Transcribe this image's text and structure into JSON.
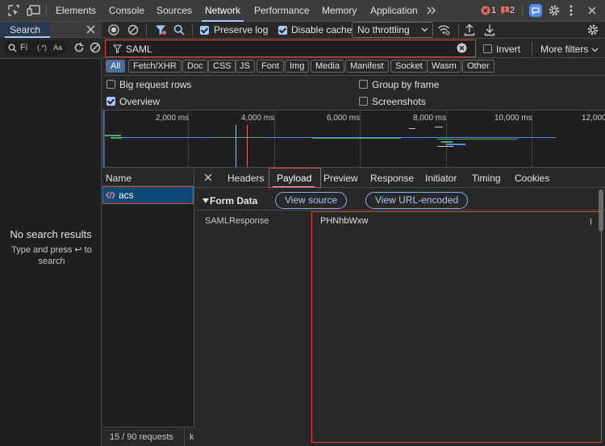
{
  "topbar": {
    "tabs": [
      "Elements",
      "Console",
      "Sources",
      "Network",
      "Performance",
      "Memory",
      "Application"
    ],
    "active_tab": "Network",
    "more_tabs_icon": "double-chevron-right-icon",
    "error_count": "1",
    "issue_count": "2",
    "error_color": "#e46962",
    "accent_color": "#a8c7fa"
  },
  "search_panel": {
    "title": "Search",
    "find_placeholder": "Fi",
    "regex_label": "(.*)",
    "case_label": "Aa",
    "empty_title": "No search results",
    "empty_hint": "Type and press ↩ to search"
  },
  "toolbar": {
    "preserve_log": "Preserve log",
    "preserve_log_checked": true,
    "disable_cache": "Disable cache",
    "disable_cache_checked": true,
    "throttling": "No throttling"
  },
  "filter": {
    "value": "SAML",
    "invert_label": "Invert",
    "invert_checked": false,
    "more_filters": "More filters"
  },
  "type_filters": [
    "All",
    "Fetch/XHR",
    "Doc",
    "CSS",
    "JS",
    "Font",
    "Img",
    "Media",
    "Manifest",
    "Socket",
    "Wasm",
    "Other"
  ],
  "active_type_filter": "All",
  "options": {
    "big_request_rows": "Big request rows",
    "big_request_rows_checked": false,
    "group_by_frame": "Group by frame",
    "group_by_frame_checked": false,
    "overview": "Overview",
    "overview_checked": true,
    "screenshots": "Screenshots",
    "screenshots_checked": false
  },
  "timeline": {
    "tick_labels": [
      "2,000 ms",
      "4,000 ms",
      "6,000 ms",
      "8,000 ms",
      "10,000 ms",
      "12,000"
    ]
  },
  "request_list": {
    "header": "Name",
    "selected_request": "acs",
    "footer": "15 / 90 requests",
    "footer_extra": "k"
  },
  "details": {
    "tabs": [
      "Headers",
      "Payload",
      "Preview",
      "Response",
      "Initiator",
      "Timing",
      "Cookies"
    ],
    "active_tab": "Payload",
    "section_title": "Form Data",
    "view_source": "View source",
    "view_url_encoded": "View URL-encoded",
    "field_name": "SAMLResponse",
    "field_value": "PHNhbWxw"
  },
  "highlight_color": "#e0452f"
}
